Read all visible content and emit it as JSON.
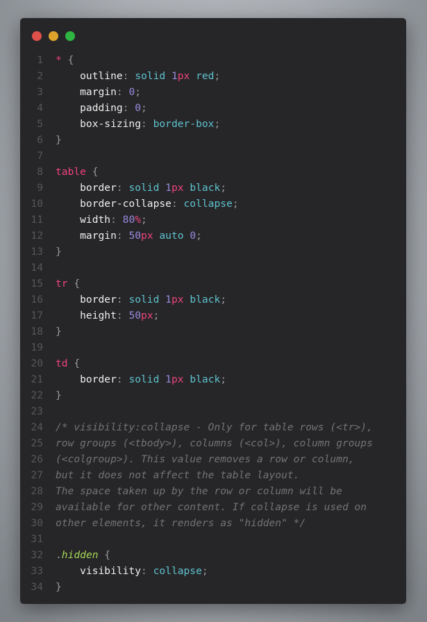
{
  "window": {
    "controls": [
      {
        "name": "close",
        "color": "#e0504b"
      },
      {
        "name": "minimize",
        "color": "#dda22a"
      },
      {
        "name": "maximize",
        "color": "#2fb542"
      }
    ]
  },
  "code_lines": [
    [
      [
        "sel",
        "*"
      ],
      [
        "punc",
        " {"
      ]
    ],
    [
      [
        "prop",
        "    outline"
      ],
      [
        "punc",
        ": "
      ],
      [
        "val",
        "solid "
      ],
      [
        "num",
        "1"
      ],
      [
        "unit",
        "px"
      ],
      [
        "val",
        " red"
      ],
      [
        "punc",
        ";"
      ]
    ],
    [
      [
        "prop",
        "    margin"
      ],
      [
        "punc",
        ": "
      ],
      [
        "num",
        "0"
      ],
      [
        "punc",
        ";"
      ]
    ],
    [
      [
        "prop",
        "    padding"
      ],
      [
        "punc",
        ": "
      ],
      [
        "num",
        "0"
      ],
      [
        "punc",
        ";"
      ]
    ],
    [
      [
        "prop",
        "    box-sizing"
      ],
      [
        "punc",
        ": "
      ],
      [
        "val",
        "border-box"
      ],
      [
        "punc",
        ";"
      ]
    ],
    [
      [
        "punc",
        "}"
      ]
    ],
    [],
    [
      [
        "sel",
        "table"
      ],
      [
        "punc",
        " {"
      ]
    ],
    [
      [
        "prop",
        "    border"
      ],
      [
        "punc",
        ": "
      ],
      [
        "val",
        "solid "
      ],
      [
        "num",
        "1"
      ],
      [
        "unit",
        "px"
      ],
      [
        "val",
        " black"
      ],
      [
        "punc",
        ";"
      ]
    ],
    [
      [
        "prop",
        "    border-collapse"
      ],
      [
        "punc",
        ": "
      ],
      [
        "val",
        "collapse"
      ],
      [
        "punc",
        ";"
      ]
    ],
    [
      [
        "prop",
        "    width"
      ],
      [
        "punc",
        ": "
      ],
      [
        "num",
        "80"
      ],
      [
        "unit",
        "%"
      ],
      [
        "punc",
        ";"
      ]
    ],
    [
      [
        "prop",
        "    margin"
      ],
      [
        "punc",
        ": "
      ],
      [
        "num",
        "50"
      ],
      [
        "unit",
        "px"
      ],
      [
        "val",
        " auto "
      ],
      [
        "num",
        "0"
      ],
      [
        "punc",
        ";"
      ]
    ],
    [
      [
        "punc",
        "}"
      ]
    ],
    [],
    [
      [
        "sel",
        "tr"
      ],
      [
        "punc",
        " {"
      ]
    ],
    [
      [
        "prop",
        "    border"
      ],
      [
        "punc",
        ": "
      ],
      [
        "val",
        "solid "
      ],
      [
        "num",
        "1"
      ],
      [
        "unit",
        "px"
      ],
      [
        "val",
        " black"
      ],
      [
        "punc",
        ";"
      ]
    ],
    [
      [
        "prop",
        "    height"
      ],
      [
        "punc",
        ": "
      ],
      [
        "num",
        "50"
      ],
      [
        "unit",
        "px"
      ],
      [
        "punc",
        ";"
      ]
    ],
    [
      [
        "punc",
        "}"
      ]
    ],
    [],
    [
      [
        "sel",
        "td"
      ],
      [
        "punc",
        " {"
      ]
    ],
    [
      [
        "prop",
        "    border"
      ],
      [
        "punc",
        ": "
      ],
      [
        "val",
        "solid "
      ],
      [
        "num",
        "1"
      ],
      [
        "unit",
        "px"
      ],
      [
        "val",
        " black"
      ],
      [
        "punc",
        ";"
      ]
    ],
    [
      [
        "punc",
        "}"
      ]
    ],
    [],
    [
      [
        "com",
        "/* visibility:collapse - Only for table rows (<tr>),"
      ]
    ],
    [
      [
        "com",
        "row groups (<tbody>), columns (<col>), column groups"
      ]
    ],
    [
      [
        "com",
        "(<colgroup>). This value removes a row or column,"
      ]
    ],
    [
      [
        "com",
        "but it does not affect the table layout."
      ]
    ],
    [
      [
        "com",
        "The space taken up by the row or column will be"
      ]
    ],
    [
      [
        "com",
        "available for other content. If collapse is used on"
      ]
    ],
    [
      [
        "com",
        "other elements, it renders as \"hidden\" */"
      ]
    ],
    [],
    [
      [
        "punc",
        "."
      ],
      [
        "cls",
        "hidden"
      ],
      [
        "punc",
        " {"
      ]
    ],
    [
      [
        "prop",
        "    visibility"
      ],
      [
        "punc",
        ": "
      ],
      [
        "val",
        "collapse"
      ],
      [
        "punc",
        ";"
      ]
    ],
    [
      [
        "punc",
        "}"
      ]
    ]
  ]
}
